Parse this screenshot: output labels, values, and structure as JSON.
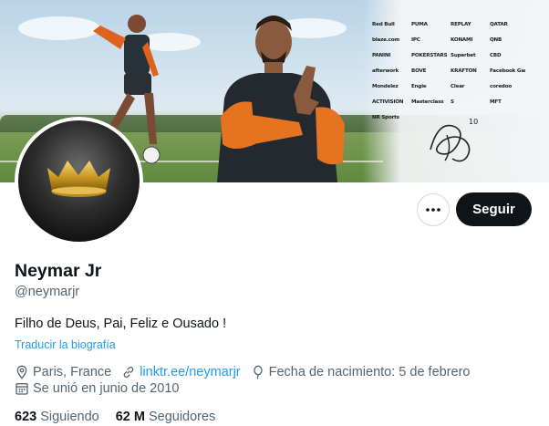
{
  "banner": {
    "sponsors": [
      "Red Bull",
      "PUMA",
      "REPLAY",
      "QATAR",
      "blaze.com",
      "IPC",
      "KONAMI",
      "QNB",
      "PANINI",
      "POKERSTARS",
      "Superbet",
      "CBD",
      "afterwork",
      "BOVE",
      "KRAFTON",
      "Facebook Gaming",
      "Mondelez",
      "Engie",
      "Clear",
      "coredoo",
      "ACTIVISION",
      "Masterclass",
      "S",
      "MFT",
      "NR Sports"
    ],
    "signature_mark": "10"
  },
  "actions": {
    "more_icon": "more-dots-icon",
    "follow_label": "Seguir"
  },
  "profile": {
    "display_name": "Neymar Jr",
    "handle": "@neymarjr",
    "bio": "Filho de Deus, Pai, Feliz e Ousado !",
    "translate_label": "Traducir la biografía",
    "location": "Paris, France",
    "website": "linktr.ee/neymarjr",
    "birthday": "Fecha de nacimiento: 5 de febrero",
    "joined": "Se unió en junio de 2010"
  },
  "stats": {
    "following_count": "623",
    "following_label": "Siguiendo",
    "followers_count": "62 M",
    "followers_label": "Seguidores"
  },
  "colors": {
    "accent": "#1d9bf0",
    "text": "#0f1419",
    "muted": "#536471",
    "follow_bg": "#0f1419"
  }
}
